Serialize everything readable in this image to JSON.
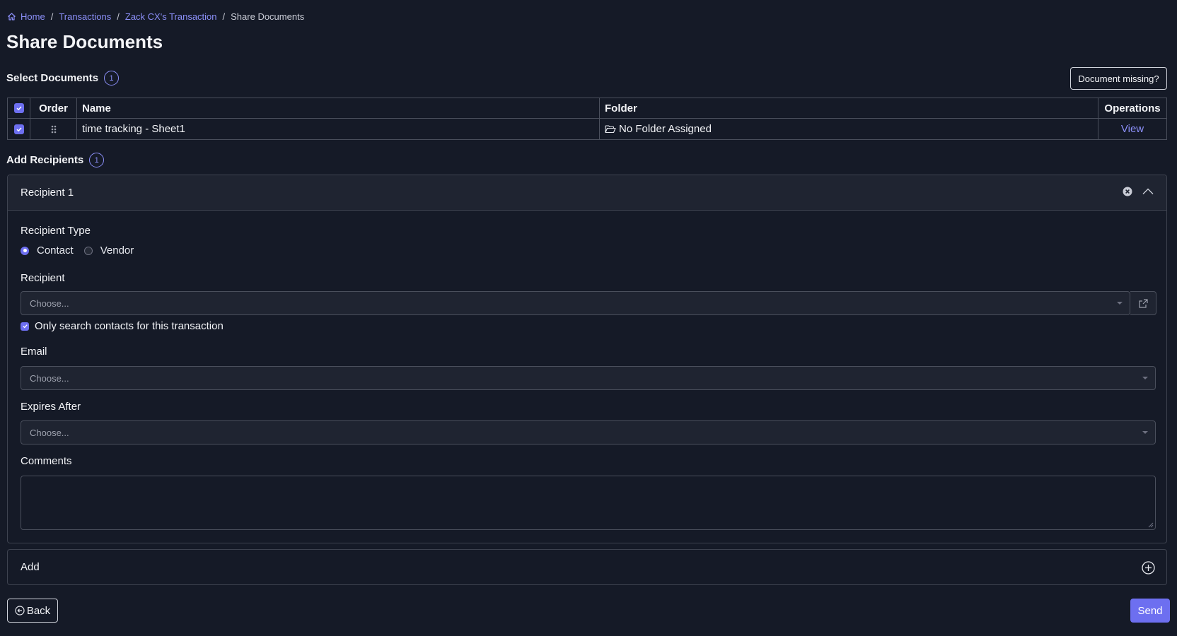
{
  "breadcrumb": {
    "home": "Home",
    "transactions": "Transactions",
    "transaction": "Zack CX's Transaction",
    "current": "Share Documents",
    "separator": "/"
  },
  "page_title": "Share Documents",
  "select_documents": {
    "title": "Select Documents",
    "count": "1",
    "missing_button": "Document missing?",
    "columns": {
      "order": "Order",
      "name": "Name",
      "folder": "Folder",
      "operations": "Operations"
    },
    "rows": [
      {
        "name": "time tracking - Sheet1",
        "folder": "No Folder Assigned",
        "operation": "View",
        "checked": true
      }
    ]
  },
  "add_recipients": {
    "title": "Add Recipients",
    "count": "1"
  },
  "recipient": {
    "header": "Recipient 1",
    "type_label": "Recipient Type",
    "type_options": [
      "Contact",
      "Vendor"
    ],
    "type_selected": "Contact",
    "recipient_label": "Recipient",
    "recipient_placeholder": "Choose...",
    "only_search_label": "Only search contacts for this transaction",
    "only_search_checked": true,
    "email_label": "Email",
    "email_placeholder": "Choose...",
    "expires_label": "Expires After",
    "expires_placeholder": "Choose...",
    "comments_label": "Comments"
  },
  "add_card": {
    "label": "Add"
  },
  "footer": {
    "back_label": "Back",
    "send_label": "Send"
  },
  "colors": {
    "background": "#151a27",
    "accent": "#6d6ff0",
    "link": "#8b8ff8"
  }
}
